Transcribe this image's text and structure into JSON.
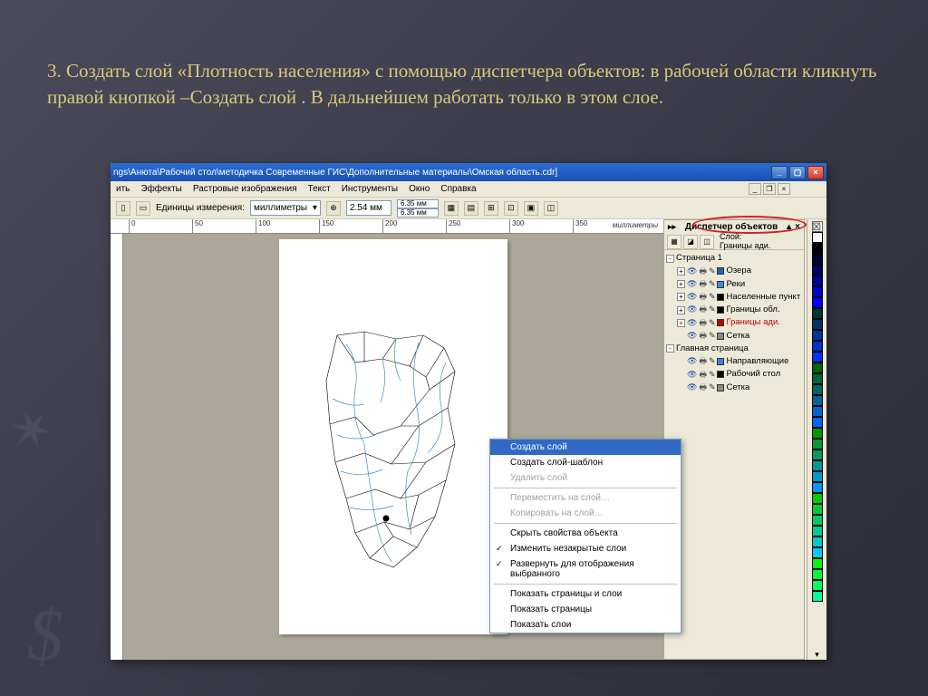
{
  "slide": {
    "heading": "3. Создать слой «Плотность населения» с помощью диспетчера объектов: в рабочей области кликнуть правой кнопкой –Создать слой . В дальнейшем работать только в этом слое."
  },
  "titlebar": {
    "text": "ngs\\Анюта\\Рабочий стол\\методичка Современные ГИС\\Дополнительные материалы\\Омская область.cdr]"
  },
  "menus": {
    "m1": "ить",
    "m2": "Эффекты",
    "m3": "Растровые изображения",
    "m4": "Текст",
    "m5": "Инструменты",
    "m6": "Окно",
    "m7": "Справка"
  },
  "propbar": {
    "units_label": "Единицы измерения:",
    "units_value": "миллиметры",
    "nudge": "2.54 мм",
    "dup_x": "6.35 мм",
    "dup_y": "6.35 мм"
  },
  "ruler": {
    "t1": "0",
    "t2": "50",
    "t3": "100",
    "t4": "150",
    "t5": "200",
    "t6": "250",
    "t7": "300",
    "t8": "350",
    "unit": "миллиметры"
  },
  "om": {
    "title": "Диспетчер объектов",
    "current_label": "Слой:",
    "current_value": "Границы ади.",
    "page1": "Страница 1",
    "layers": {
      "l1": "Озера",
      "l2": "Реки",
      "l3": "Населенные пункт",
      "l4": "Границы обл.",
      "l5": "Границы ади.",
      "l6": "Сетка"
    },
    "master": "Главная страница",
    "mlayers": {
      "m1": "Направляющие",
      "m2": "Рабочий стол",
      "m3": "Сетка"
    }
  },
  "ctx": {
    "i1": "Создать слой",
    "i2": "Создать слой-шаблон",
    "i3": "Удалить слой",
    "i4": "Переместить на слой…",
    "i5": "Копировать на слой…",
    "i6": "Скрыть свойства объекта",
    "i7": "Изменить незакрытые слои",
    "i8": "Развернуть для отображения выбранного",
    "i9": "Показать страницы и слои",
    "i10": "Показать страницы",
    "i11": "Показать слои"
  },
  "colors": [
    "#fff",
    "#000",
    "#003",
    "#006",
    "#009",
    "#00c",
    "#00f",
    "#033",
    "#036",
    "#039",
    "#03c",
    "#03f",
    "#060",
    "#063",
    "#066",
    "#069",
    "#06c",
    "#06f",
    "#090",
    "#093",
    "#096",
    "#099",
    "#09c",
    "#09f",
    "#0c0",
    "#0c3",
    "#0c6",
    "#0c9",
    "#0cc",
    "#0cf",
    "#0f0",
    "#0f3",
    "#0f6",
    "#0f9",
    "#300",
    "#600",
    "#900",
    "#c00"
  ]
}
